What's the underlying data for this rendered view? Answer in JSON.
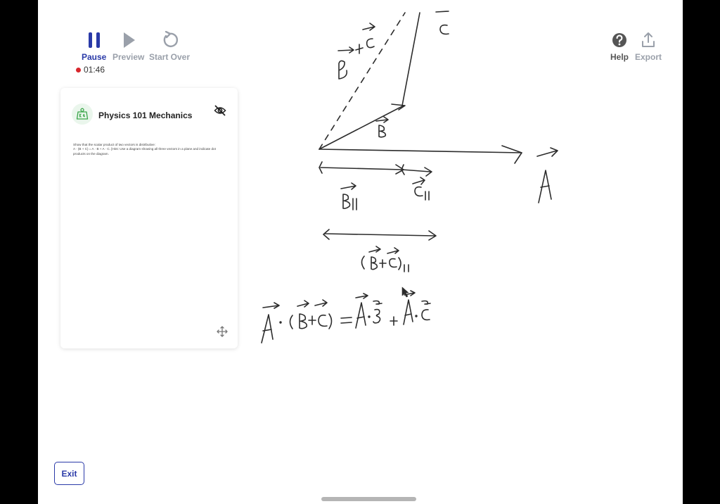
{
  "toolbar": {
    "pause_label": "Pause",
    "preview_label": "Preview",
    "start_over_label": "Start Over",
    "help_label": "Help",
    "export_label": "Export",
    "timer": "01:46",
    "active_color": "#2a3aa8",
    "recording_color": "#d8262c"
  },
  "card": {
    "title": "Physics 101 Mechanics",
    "icon": "kg-weight-icon",
    "problem_line1": "Show that the scalar product of two vectors is distributive:",
    "problem_line2": "A · (B + C) = A · B + A · C. [Hint: Use a diagram showing all three vectors in a plane and indicate dot products on the diagram."
  },
  "exit_label": "Exit"
}
